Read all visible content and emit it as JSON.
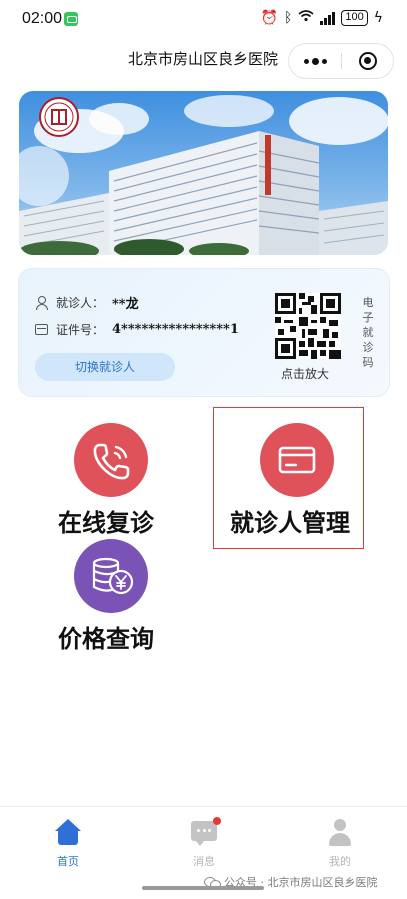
{
  "status_bar": {
    "time": "02:00",
    "battery": "100",
    "icons": [
      "app-notification-icon",
      "alarm-icon",
      "bluetooth-icon",
      "wifi-icon",
      "signal-icon",
      "battery-icon",
      "charging-icon"
    ]
  },
  "header": {
    "title": "北京市房山区良乡医院",
    "icons": [
      "more-icon",
      "close-miniprogram-icon"
    ]
  },
  "banner": {
    "content": "hospital-building-photo",
    "logo": "hospital-logo"
  },
  "patient_card": {
    "patient_label": "就诊人：",
    "patient_name": "**龙",
    "id_label": "证件号：",
    "id_value": "4****************1",
    "switch_button": "切换就诊人",
    "qr_caption": "点击放大",
    "qr_side_chars": [
      "电",
      "子",
      "就",
      "诊",
      "码"
    ]
  },
  "menu": [
    {
      "label": "在线复诊",
      "icon": "phone-icon",
      "color": "#e0525a"
    },
    {
      "label": "就诊人管理",
      "icon": "card-icon",
      "color": "#e0525a",
      "highlighted": true
    },
    {
      "label": "价格查询",
      "icon": "coins-yen-icon",
      "color": "#7b52b6"
    }
  ],
  "colors": {
    "accent": "#2f6fd6",
    "highlight_border": "#e53935",
    "card_bg": "#e8f3fd"
  },
  "tab_bar": {
    "tabs": [
      {
        "label": "首页",
        "icon": "home-icon",
        "active": true
      },
      {
        "label": "消息",
        "icon": "message-icon",
        "active": false,
        "badge": true
      },
      {
        "label": "我的",
        "icon": "profile-icon",
        "active": false
      }
    ]
  },
  "watermark": {
    "text": "公众号 · 北京市房山区良乡医院"
  }
}
